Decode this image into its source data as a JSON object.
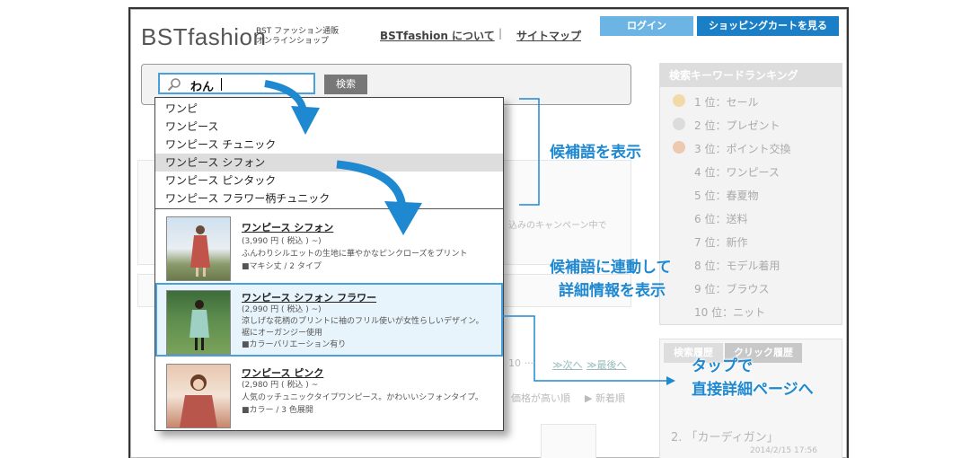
{
  "site": {
    "logo": "BSTfashion",
    "tagline_1": "BST ファッション通販",
    "tagline_2": "オンラインショップ",
    "nav_about": "BSTfashion について",
    "nav_separator": "|",
    "nav_sitemap": "サイトマップ",
    "login_label": "ログイン",
    "cart_label": "ショッピングカートを見る",
    "colors": {
      "login": "#6cb4e4",
      "cart": "#1b7fc7",
      "callout": "#1e88d0",
      "highlight_border": "#4aa0dc"
    }
  },
  "search": {
    "value": "わん",
    "button_label": "検索",
    "icon": "search-icon"
  },
  "suggestions": [
    {
      "label": "ワンピ",
      "highlighted": false
    },
    {
      "label": "ワンピース",
      "highlighted": false
    },
    {
      "label": "ワンピース チュニック",
      "highlighted": false
    },
    {
      "label": "ワンピース シフォン",
      "highlighted": true
    },
    {
      "label": "ワンピース ピンタック",
      "highlighted": false
    },
    {
      "label": "ワンピース フラワー柄チュニック",
      "highlighted": false
    }
  ],
  "products": [
    {
      "name": "ワンピース シフォン",
      "price": "(3,990 円 ( 税込 ) ~)",
      "desc": "ふんわりシルエットの生地に華やかなピンクローズをプリント",
      "desc2": "",
      "note": "■マキシ丈 / 2 タイプ",
      "highlighted": false
    },
    {
      "name": "ワンピース シフォン フラワー",
      "price": "(2,990 円 ( 税込 ) ~)",
      "desc": "涼しげな花柄のプリントに袖のフリル使いが女性らしいデザイン。",
      "desc2": "裾にオーガンジー使用",
      "note": "■カラーバリエーション有り",
      "highlighted": true
    },
    {
      "name": "ワンピース ピンク",
      "price": "(2,980 円 ( 税込 ) ~",
      "desc": "人気のッチュニックタイプワンピース。かわいいシフォンタイプ。",
      "desc2": "",
      "note": "■カラー / 3 色展開",
      "highlighted": false
    }
  ],
  "sidebar": {
    "title": "検索キーワードランキング",
    "ranking": [
      "1 位：セール",
      "2 位：プレゼント",
      "3 位：ポイント交換",
      "4 位：ワンピース",
      "5 位：春夏物",
      "6 位：送料",
      "7 位：新作",
      "8 位：モデル着用",
      "9 位：ブラウス",
      "10 位：ニット"
    ]
  },
  "history": {
    "tab_search": "検索履歴",
    "tab_click": "クリック履歴",
    "item_2": "2. 「カーディガン」",
    "item_2_date": "2014/2/15 17:56"
  },
  "background_fragments": {
    "campaign": "込みのキャンペーン中で",
    "pager_ellipsis": "10 ···",
    "pager_next": "≫次へ",
    "pager_last": "≫最後へ",
    "sort_price": "価格が高い順",
    "sort_new": "▶ 新着順"
  },
  "callouts": {
    "candidates": "候補語を表示",
    "linked_1": "候補語に連動して",
    "linked_2": "詳細情報を表示",
    "tap_1": "タップで",
    "tap_2": "直接詳細ページへ"
  }
}
